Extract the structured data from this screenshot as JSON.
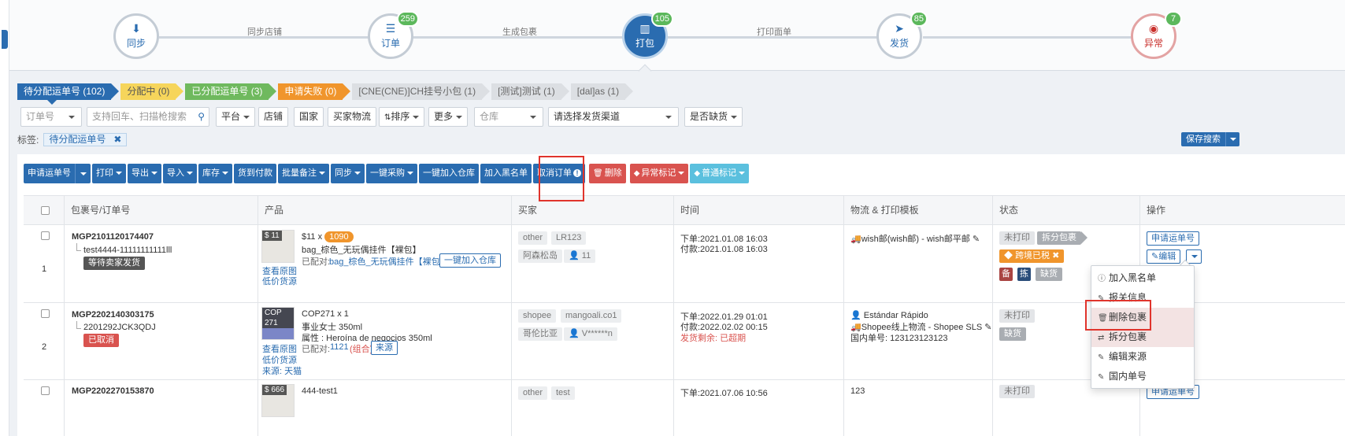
{
  "workflow": {
    "steps": [
      {
        "label": "同步",
        "icon": "download-icon",
        "badge": ""
      },
      {
        "label": "订单",
        "icon": "list-icon",
        "badge": "259"
      },
      {
        "label": "打包",
        "icon": "barcode-icon",
        "badge": "105"
      },
      {
        "label": "发货",
        "icon": "send-icon",
        "badge": "85"
      },
      {
        "label": "异常",
        "icon": "eye-slash-icon",
        "badge": "7"
      }
    ],
    "edges": [
      "同步店铺",
      "生成包裹",
      "打印面单"
    ]
  },
  "status_tabs": [
    {
      "label": "待分配运单号 (102)",
      "color": "#2a6cb0"
    },
    {
      "label": "分配中 (0)",
      "color": "#f6d55b"
    },
    {
      "label": "已分配运单号 (3)",
      "color": "#6fb95e"
    },
    {
      "label": "申请失败 (0)",
      "color": "#f0952c"
    },
    {
      "label": "[CNE(CNE)]CH挂号小包 (1)",
      "color": "#dcdfe3"
    },
    {
      "label": "[测试]测试 (1)",
      "color": "#dcdfe3"
    },
    {
      "label": "[dal]as (1)",
      "color": "#dcdfe3"
    }
  ],
  "filters": {
    "order_select": "订单号",
    "search_placeholder": "支持回车、扫描枪搜索",
    "platform": "平台",
    "shop": "店铺",
    "country": "国家",
    "buyer_logistics": "买家物流",
    "sort": "排序",
    "more": "更多",
    "warehouse": "仓库",
    "channel": "请选择发货渠道",
    "stockout": "是否缺货",
    "tag_label": "标签:",
    "tag_chip": "待分配运单号",
    "tag_remove": "✖",
    "save_search": "保存搜索"
  },
  "toolbar": {
    "apply_tracking": "申请运单号",
    "print": "打印",
    "export": "导出",
    "import": "导入",
    "stock": "库存",
    "cod": "货到付款",
    "batch_remark": "批量备注",
    "sync": "同步",
    "one_click_purchase": "一键采购",
    "add_to_warehouse": "一键加入仓库",
    "add_blacklist": "加入黑名单",
    "cancel_order": "取消订单",
    "delete": "删除",
    "abnormal_mark": "异常标记",
    "normal_mark": "普通标记"
  },
  "table": {
    "headers": [
      "包裹号/订单号",
      "产品",
      "买家",
      "时间",
      "物流 & 打印模板",
      "状态",
      "操作"
    ],
    "rows": [
      {
        "index": "1",
        "package_no": "MGP2101120174407",
        "order_no": "test4444-11111111111lll",
        "order_status": "等待卖家发货",
        "product": {
          "price_tag": "$ 11",
          "price_qty": "$11 x",
          "qty_badge": "1090",
          "name": "bag_棕色_无玩偶挂件【裸包】",
          "matched_prefix": "已配对:",
          "matched": "bag_棕色_无玩偶挂件【裸包】",
          "add_btn": "一键加入仓库",
          "view_image": "查看原图",
          "low_price": "低价货源"
        },
        "buyer": {
          "platform": "other",
          "store": "LR123",
          "country": "阿森松岛",
          "user": "11"
        },
        "time": {
          "ordered": "下单:2021.01.08 16:03",
          "paid": "付款:2021.01.08 16:03"
        },
        "logistics": {
          "line1": "wish邮(wish邮) - wish邮平邮"
        },
        "status": {
          "print": "未打印",
          "split": "拆分包裹",
          "tax": "跨境已税",
          "tags": [
            "备",
            "拣",
            "缺货"
          ]
        },
        "ops": {
          "apply": "申请运单号",
          "edit": "编辑"
        }
      },
      {
        "index": "2",
        "package_no": "MGP2202140303175",
        "order_no": "2201292JCK3QDJ",
        "order_status": "已取消",
        "product": {
          "price_tag": "COP 271",
          "price_qty": "COP271 x 1",
          "name": "事业女士 350ml",
          "attr": "属性 : Heroína de negocios 350ml",
          "matched_prefix": "已配对:",
          "matched": "1121",
          "matched_combo": "(组合)",
          "source_btn": "来源",
          "view_image": "查看原图",
          "low_price": "低价货源",
          "source": "来源: 天猫"
        },
        "buyer": {
          "platform": "shopee",
          "store": "mangoali.co1",
          "country": "哥伦比亚",
          "user": "V******n"
        },
        "time": {
          "ordered": "下单:2022.01.29 01:01",
          "paid": "付款:2022.02.02 00:15",
          "remaining": "发货剩余: 已超期"
        },
        "logistics": {
          "line1": "Estándar Rápido",
          "line2": "Shopee线上物流 - Shopee SLS",
          "line3": "国内单号: 123123123123"
        },
        "status": {
          "print": "未打印",
          "stock": "缺货"
        }
      },
      {
        "index": "3",
        "package_no": "MGP2202270153870",
        "product": {
          "price_tag": "$ 666",
          "name_partial": "444-test1"
        },
        "buyer": {
          "platform": "other",
          "store": "test"
        },
        "time": {
          "ordered": "下单:2021.07.06 10:56"
        },
        "logistics": {
          "line1": "123"
        },
        "status": {
          "print": "未打印"
        },
        "ops": {
          "apply": "申请运单号"
        }
      }
    ]
  },
  "dropdown": {
    "items": [
      {
        "icon": "info-icon",
        "label": "加入黑名单"
      },
      {
        "icon": "edit-icon",
        "label": "报关信息"
      },
      {
        "icon": "trash-icon",
        "label": "删除包裹"
      },
      {
        "icon": "split-icon",
        "label": "拆分包裹"
      },
      {
        "icon": "edit-icon",
        "label": "编辑来源"
      },
      {
        "icon": "edit-icon",
        "label": "国内单号"
      }
    ]
  },
  "colors": {
    "primary": "#2a6cb0",
    "danger": "#d9534f",
    "success": "#5cb85c",
    "warning": "#f0952c",
    "highlight": "#e0342c"
  }
}
